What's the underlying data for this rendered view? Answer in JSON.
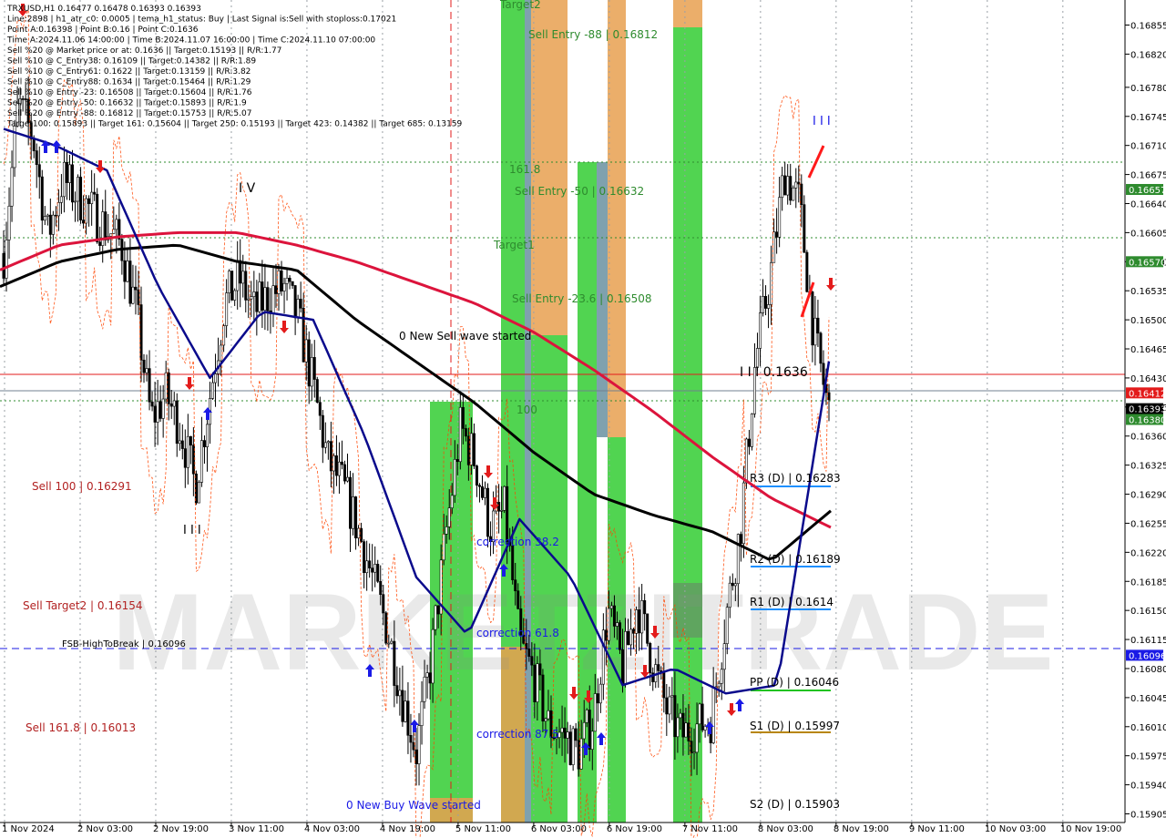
{
  "header": {
    "lines": [
      "TRXUSD,H1  0.16477 0.16478 0.16393 0.16393",
      "Line:2898 | h1_atr_c0: 0.0005 | tema_h1_status: Buy | Last Signal is:Sell with stoploss:0.17021",
      "Point A:0.16398 | Point B:0.16 | Point C:0.1636",
      "Time A:2024.11.06 14:00:00 | Time B:2024.11.07 16:00:00 | Time C:2024.11.10 07:00:00",
      "Sell %20 @ Market price or at: 0.1636 || Target:0.15193 || R/R:1.77",
      "Sell %10 @ C_Entry38: 0.16109 || Target:0.14382 || R/R:1.89",
      "Sell %10 @ C_Entry61: 0.1622 || Target:0.13159 || R/R:3.82",
      "Sell %10 @ C_Entry88: 0.1634 || Target:0.15464 || R/R:1.29",
      "Sell %10 @ Entry -23: 0.16508 || Target:0.15604 || R/R:1.76",
      "Sell %20 @ Entry -50: 0.16632 || Target:0.15893 || R/R:1.9",
      "Sell %20 @ Entry -88: 0.16812 || Target:0.15753 || R/R:5.07",
      "Target100: 0.15893 || Target 161: 0.15604 || Target 250: 0.15193 || Target 423: 0.14382 || Target 685: 0.13159"
    ]
  },
  "colors": {
    "background": "#ffffff",
    "candle": "#000000",
    "ma_red": "#dc143c",
    "ma_black": "#000000",
    "tema_blue": "#0a0a8c",
    "green_zone": "#32cd32",
    "orange_zone": "#e8a050",
    "grid": "#9aa0a6",
    "dark_red_label": "#b22222",
    "green_label": "#2e8b2e",
    "blue_label": "#0000cd"
  },
  "zone_labels": [
    {
      "text": "Target2"
    },
    {
      "text": "Sell Entry -88 | 0.16812"
    },
    {
      "text": "161.8"
    },
    {
      "text": "Sell Entry -50 | 0.16632"
    },
    {
      "text": "Target1"
    },
    {
      "text": "Sell Entry -23.6 | 0.16508"
    },
    {
      "text": "100"
    }
  ],
  "annotations": {
    "wave_iv": "I V",
    "wave_iii_top": "I I I",
    "wave_iii_left": "I I I",
    "wave_iii_price": "I I I 0.1636",
    "sell_wave": "0 New Sell wave started",
    "buy_wave": "0 New Buy Wave started",
    "corr_382": "correction 38.2",
    "corr_618": "correction 61.8",
    "corr_875": "correction 87.5",
    "sell_100": "Sell 100 | 0.16291",
    "sell_target2": "Sell Target2 | 0.16154",
    "sell_1618": "Sell 161.8 | 0.16013",
    "fsb": "FSB-HighToBreak | 0.16096",
    "watermark": "MARKETZITRADE"
  },
  "pivots": [
    {
      "label": "R3 (D) | 0.16283"
    },
    {
      "label": "R2 (D) | 0.16189"
    },
    {
      "label": "R1 (D) | 0.1614"
    },
    {
      "label": "PP (D) | 0.16046"
    },
    {
      "label": "S1 (D) | 0.15997"
    },
    {
      "label": "S2 (D) | 0.15903"
    }
  ],
  "price_tags": [
    {
      "text": "0.16657",
      "bg": "#2e8b2e"
    },
    {
      "text": "0.16570",
      "bg": "#2e8b2e"
    },
    {
      "text": "0.16412",
      "bg": "#e31b1b"
    },
    {
      "text": "0.16393",
      "bg": "#000000"
    },
    {
      "text": "0.16380",
      "bg": "#2e8b2e"
    },
    {
      "text": "0.16096",
      "bg": "#1a1ae6"
    }
  ],
  "chart_data": {
    "type": "candlestick",
    "symbol": "TRXUSD",
    "timeframe": "H1",
    "ylim": [
      0.15905,
      0.16855
    ],
    "y_ticks": [
      "0.16855",
      "0.16820",
      "0.16780",
      "0.16745",
      "0.16710",
      "0.16675",
      "0.16640",
      "0.16605",
      "0.16570",
      "0.16535",
      "0.16500",
      "0.16465",
      "0.16430",
      "0.16395",
      "0.16360",
      "0.16325",
      "0.16290",
      "0.16255",
      "0.16220",
      "0.16185",
      "0.16150",
      "0.16115",
      "0.16080",
      "0.16045",
      "0.16010",
      "0.15975",
      "0.15940",
      "0.15905"
    ],
    "x_ticks": [
      "1 Nov 2024",
      "2 Nov 03:00",
      "2 Nov 19:00",
      "3 Nov 11:00",
      "4 Nov 03:00",
      "4 Nov 19:00",
      "5 Nov 11:00",
      "6 Nov 03:00",
      "6 Nov 19:00",
      "7 Nov 11:00",
      "8 Nov 03:00",
      "8 Nov 19:00",
      "9 Nov 11:00",
      "10 Nov 03:00",
      "10 Nov 19:00"
    ],
    "close_path": [
      0.1658,
      0.1676,
      0.1672,
      0.166,
      0.1667,
      0.1665,
      0.1663,
      0.1661,
      0.1659,
      0.1651,
      0.1638,
      0.1641,
      0.1637,
      0.163,
      0.1641,
      0.1652,
      0.1655,
      0.1651,
      0.1653,
      0.1654,
      0.165,
      0.1642,
      0.1633,
      0.163,
      0.1625,
      0.1619,
      0.1613,
      0.1605,
      0.1598,
      0.1609,
      0.1624,
      0.1637,
      0.1633,
      0.1625,
      0.1627,
      0.1611,
      0.1607,
      0.1601,
      0.16,
      0.1598,
      0.1602,
      0.1615,
      0.1608,
      0.1616,
      0.1609,
      0.1603,
      0.16,
      0.1601,
      0.1602,
      0.1614,
      0.1625,
      0.1645,
      0.1655,
      0.1668,
      0.1664,
      0.1648,
      0.1639
    ],
    "ma_red": [
      0.1656,
      0.1659,
      0.166,
      0.16605,
      0.16605,
      0.1659,
      0.1657,
      0.16545,
      0.1652,
      0.16485,
      0.1644,
      0.1639,
      0.16335,
      0.16285,
      0.1625
    ],
    "ma_black": [
      0.1654,
      0.1657,
      0.16585,
      0.1659,
      0.1657,
      0.1656,
      0.165,
      0.1645,
      0.164,
      0.1634,
      0.1629,
      0.16265,
      0.16245,
      0.1621,
      0.1627
    ],
    "tema_blue": [
      0.1673,
      0.1671,
      0.1668,
      0.1654,
      0.1643,
      0.1651,
      0.165,
      0.1636,
      0.1619,
      0.1612,
      0.1626,
      0.1619,
      0.1606,
      0.1608,
      0.1605,
      0.1606,
      0.1645
    ]
  }
}
